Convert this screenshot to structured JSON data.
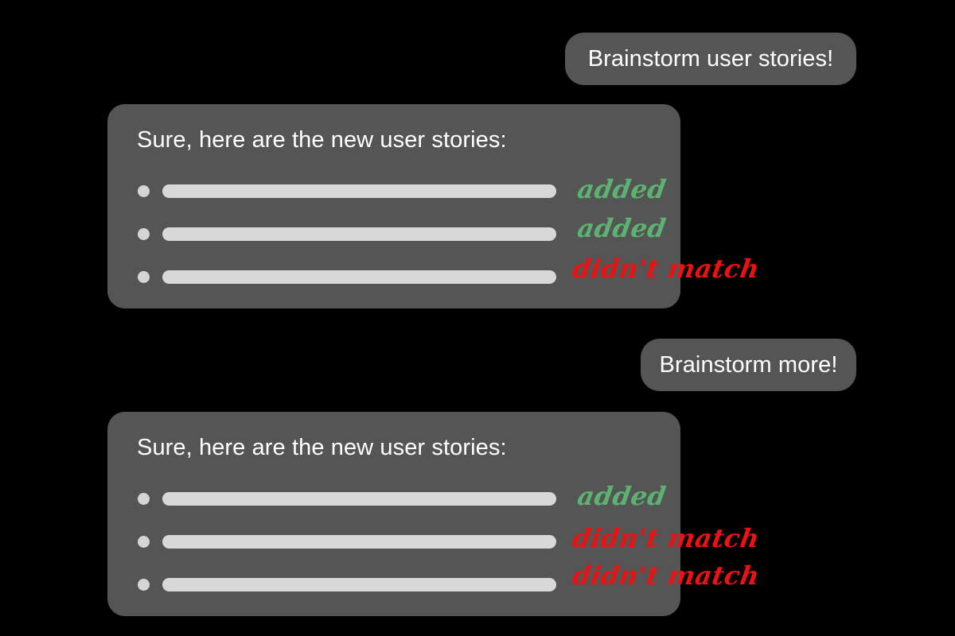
{
  "background_color": "#000000",
  "palette": {
    "bubble_gray": "#555555",
    "bubble_text": "#ffffff",
    "bar_fill": "#d8d8d8",
    "bullet_fill": "#d5d5d5",
    "annotation_added": "#5cb270",
    "annotation_didnt_match": "#ee1111"
  },
  "conversation": {
    "messages": [
      {
        "role": "user",
        "text": "Brainstorm user stories!"
      },
      {
        "role": "assistant",
        "heading": "Sure, here are the new user stories:",
        "stories": [
          {
            "label": "",
            "annotation": "added",
            "status": "added"
          },
          {
            "label": "",
            "annotation": "added",
            "status": "added"
          },
          {
            "label": "",
            "annotation": "didn't match",
            "status": "didnt-match"
          }
        ]
      },
      {
        "role": "user",
        "text": "Brainstorm more!"
      },
      {
        "role": "assistant",
        "heading": "Sure, here are the new user stories:",
        "stories": [
          {
            "label": "",
            "annotation": "added",
            "status": "added"
          },
          {
            "label": "",
            "annotation": "didn't match",
            "status": "didnt-match"
          },
          {
            "label": "",
            "annotation": "didn't match",
            "status": "didnt-match"
          }
        ]
      }
    ]
  }
}
